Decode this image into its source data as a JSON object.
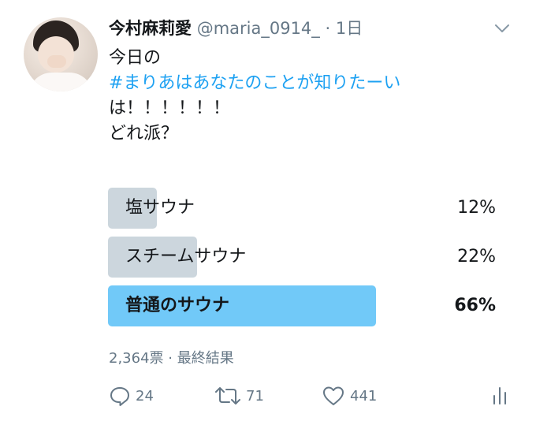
{
  "tweet": {
    "author": {
      "display_name": "今村麻莉愛",
      "handle": "@maria_0914_",
      "separator": "·",
      "time": "1日"
    },
    "text_lines": {
      "line1": "今日の",
      "hashtag": "#まりあはあなたのことが知りたーい",
      "line3": "は！！！！！！",
      "line4": "どれ派？"
    },
    "poll": {
      "options": [
        {
          "label": "塩サウナ",
          "percent_text": "12%",
          "percent": 12
        },
        {
          "label": "スチームサウナ",
          "percent_text": "22%",
          "percent": 22
        },
        {
          "label": "普通のサウナ",
          "percent_text": "66%",
          "percent": 66,
          "winner": true
        }
      ],
      "votes": "2,364票",
      "meta_separator": "·",
      "status": "最終結果"
    },
    "actions": {
      "replies": "24",
      "retweets": "71",
      "likes": "441"
    },
    "icons": {
      "menu": "chevron-down-icon",
      "reply": "reply-icon",
      "retweet": "retweet-icon",
      "like": "heart-icon",
      "analytics": "analytics-icon"
    },
    "colors": {
      "accent": "#1da1f2",
      "winner_fill": "#71c9f8",
      "other_fill": "#ccd6dd",
      "muted_text": "#657786"
    }
  }
}
